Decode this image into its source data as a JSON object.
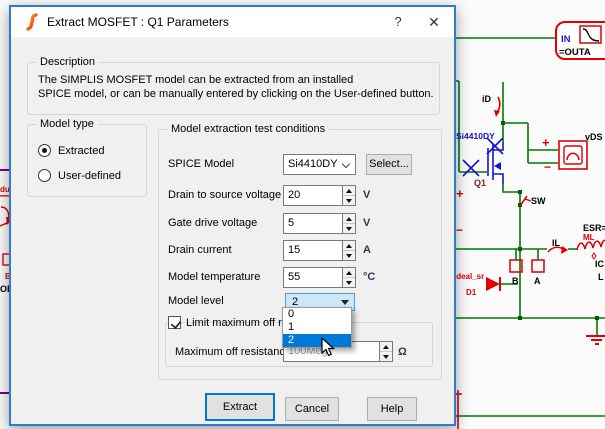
{
  "window": {
    "title": "Extract MOSFET : Q1 Parameters",
    "help_label": "?",
    "close_label": "✕"
  },
  "description": {
    "group_label": "Description",
    "line1": "The SIMPLIS MOSFET model can be extracted from an installed",
    "line2": "SPICE model, or can be manually entered by clicking on the User-defined button."
  },
  "model_type": {
    "group_label": "Model type",
    "options": [
      {
        "label": "Extracted",
        "selected": true
      },
      {
        "label": "User-defined",
        "selected": false
      }
    ]
  },
  "conditions": {
    "group_label": "Model extraction test conditions",
    "spice_model": {
      "label": "SPICE Model",
      "value": "Si4410DY",
      "select_button": "Select..."
    },
    "fields": [
      {
        "label": "Drain to source voltage",
        "value": "20",
        "unit": "V"
      },
      {
        "label": "Gate drive voltage",
        "value": "5",
        "unit": "V"
      },
      {
        "label": "Drain current",
        "value": "15",
        "unit": "A"
      },
      {
        "label": "Model temperature",
        "value": "55",
        "unit": "°C"
      }
    ],
    "model_level": {
      "label": "Model level",
      "value": "2",
      "options": [
        "0",
        "1",
        "2"
      ],
      "highlighted_option": "2"
    },
    "limit_checkbox": {
      "label": "Limit maximum off resistance",
      "checked": true
    },
    "max_off_resistance": {
      "label": "Maximum off resistance",
      "value": "100Meg",
      "unit": "Ω"
    }
  },
  "buttons": {
    "extract": "Extract",
    "cancel": "Cancel",
    "help": "Help"
  },
  "schematic": {
    "labels": {
      "in": "IN",
      "outa": "=OUTA",
      "id_probe": "iD",
      "part": "Si4410DY",
      "q1": "Q1",
      "vds": "vDS",
      "plus": "+",
      "minus": "−",
      "sw": "SW",
      "il": "IL",
      "esr": "ESR=",
      "ml": "ML",
      "ic": "IC",
      "l": "L",
      "b": "B",
      "a": "A",
      "ideal_sr": "ideal_sr",
      "d1": "D1",
      "ob": "OB",
      "duc": "duc",
      "b_fragment": "B"
    },
    "colors": {
      "wire": "#007a00",
      "component": "#e00000",
      "selected": "#1414cc",
      "bus": "#800080"
    }
  },
  "colors": {
    "accent": "#0078d7",
    "dialog_border": "#2e7bd2",
    "combo_hover": "#cde8f6",
    "disabled_text": "#9e9e9e",
    "highlight_text": "#ffffff"
  }
}
